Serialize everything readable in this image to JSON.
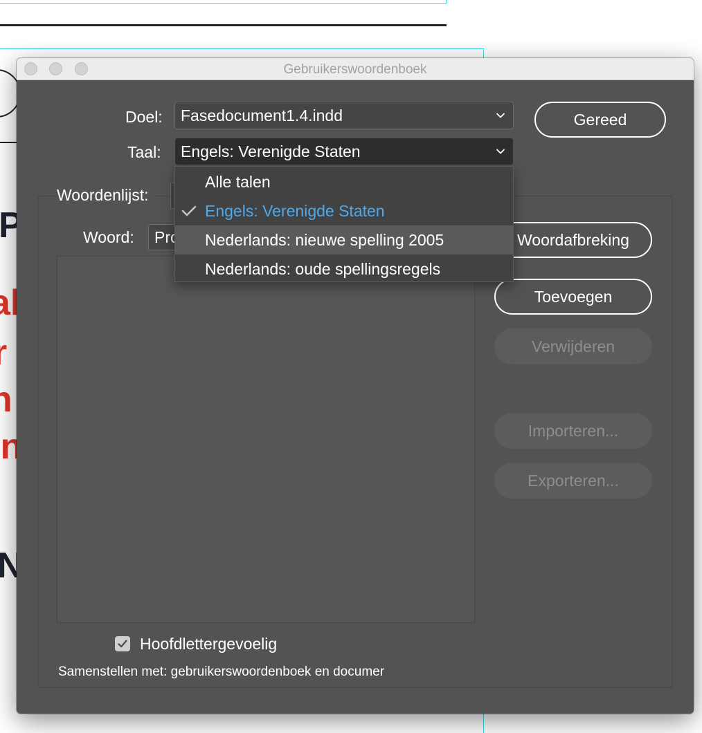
{
  "window": {
    "title": "Gebruikerswoordenboek"
  },
  "form": {
    "doel_label": "Doel:",
    "doel_value": "Fasedocument1.4.indd",
    "taal_label": "Taal:",
    "taal_value": "Engels: Verenigde Staten",
    "woordenlijst_label": "Woordenlijst:",
    "woord_label": "Woord:",
    "woord_value": "Pro"
  },
  "buttons": {
    "gereed": "Gereed",
    "woordafbreking": "Woordafbreking",
    "toevoegen": "Toevoegen",
    "verwijderen": "Verwijderen",
    "importeren": "Importeren...",
    "exporteren": "Exporteren..."
  },
  "checkbox": {
    "label": "Hoofdlettergevoelig",
    "checked": true
  },
  "footnote": "Samenstellen met: gebruikerswoordenboek en documer",
  "taal_dropdown": {
    "open": true,
    "options": [
      {
        "label": "Alle talen"
      },
      {
        "label": "Engels: Verenigde Staten"
      },
      {
        "label": "Nederlands: nieuwe spelling 2005"
      },
      {
        "label": "Nederlands: oude spellingsregels"
      }
    ],
    "selected_index": 1,
    "hover_index": 2
  },
  "colors": {
    "dialog_bg": "#535353",
    "selected_option": "#4fa9ea",
    "disabled_text": "#8d8d8d",
    "background_accent_red": "#e0352b",
    "guide_cyan": "#3fd9e6"
  },
  "icons": {
    "chevron": "chevron-down-icon",
    "check": "checkmark-icon"
  }
}
